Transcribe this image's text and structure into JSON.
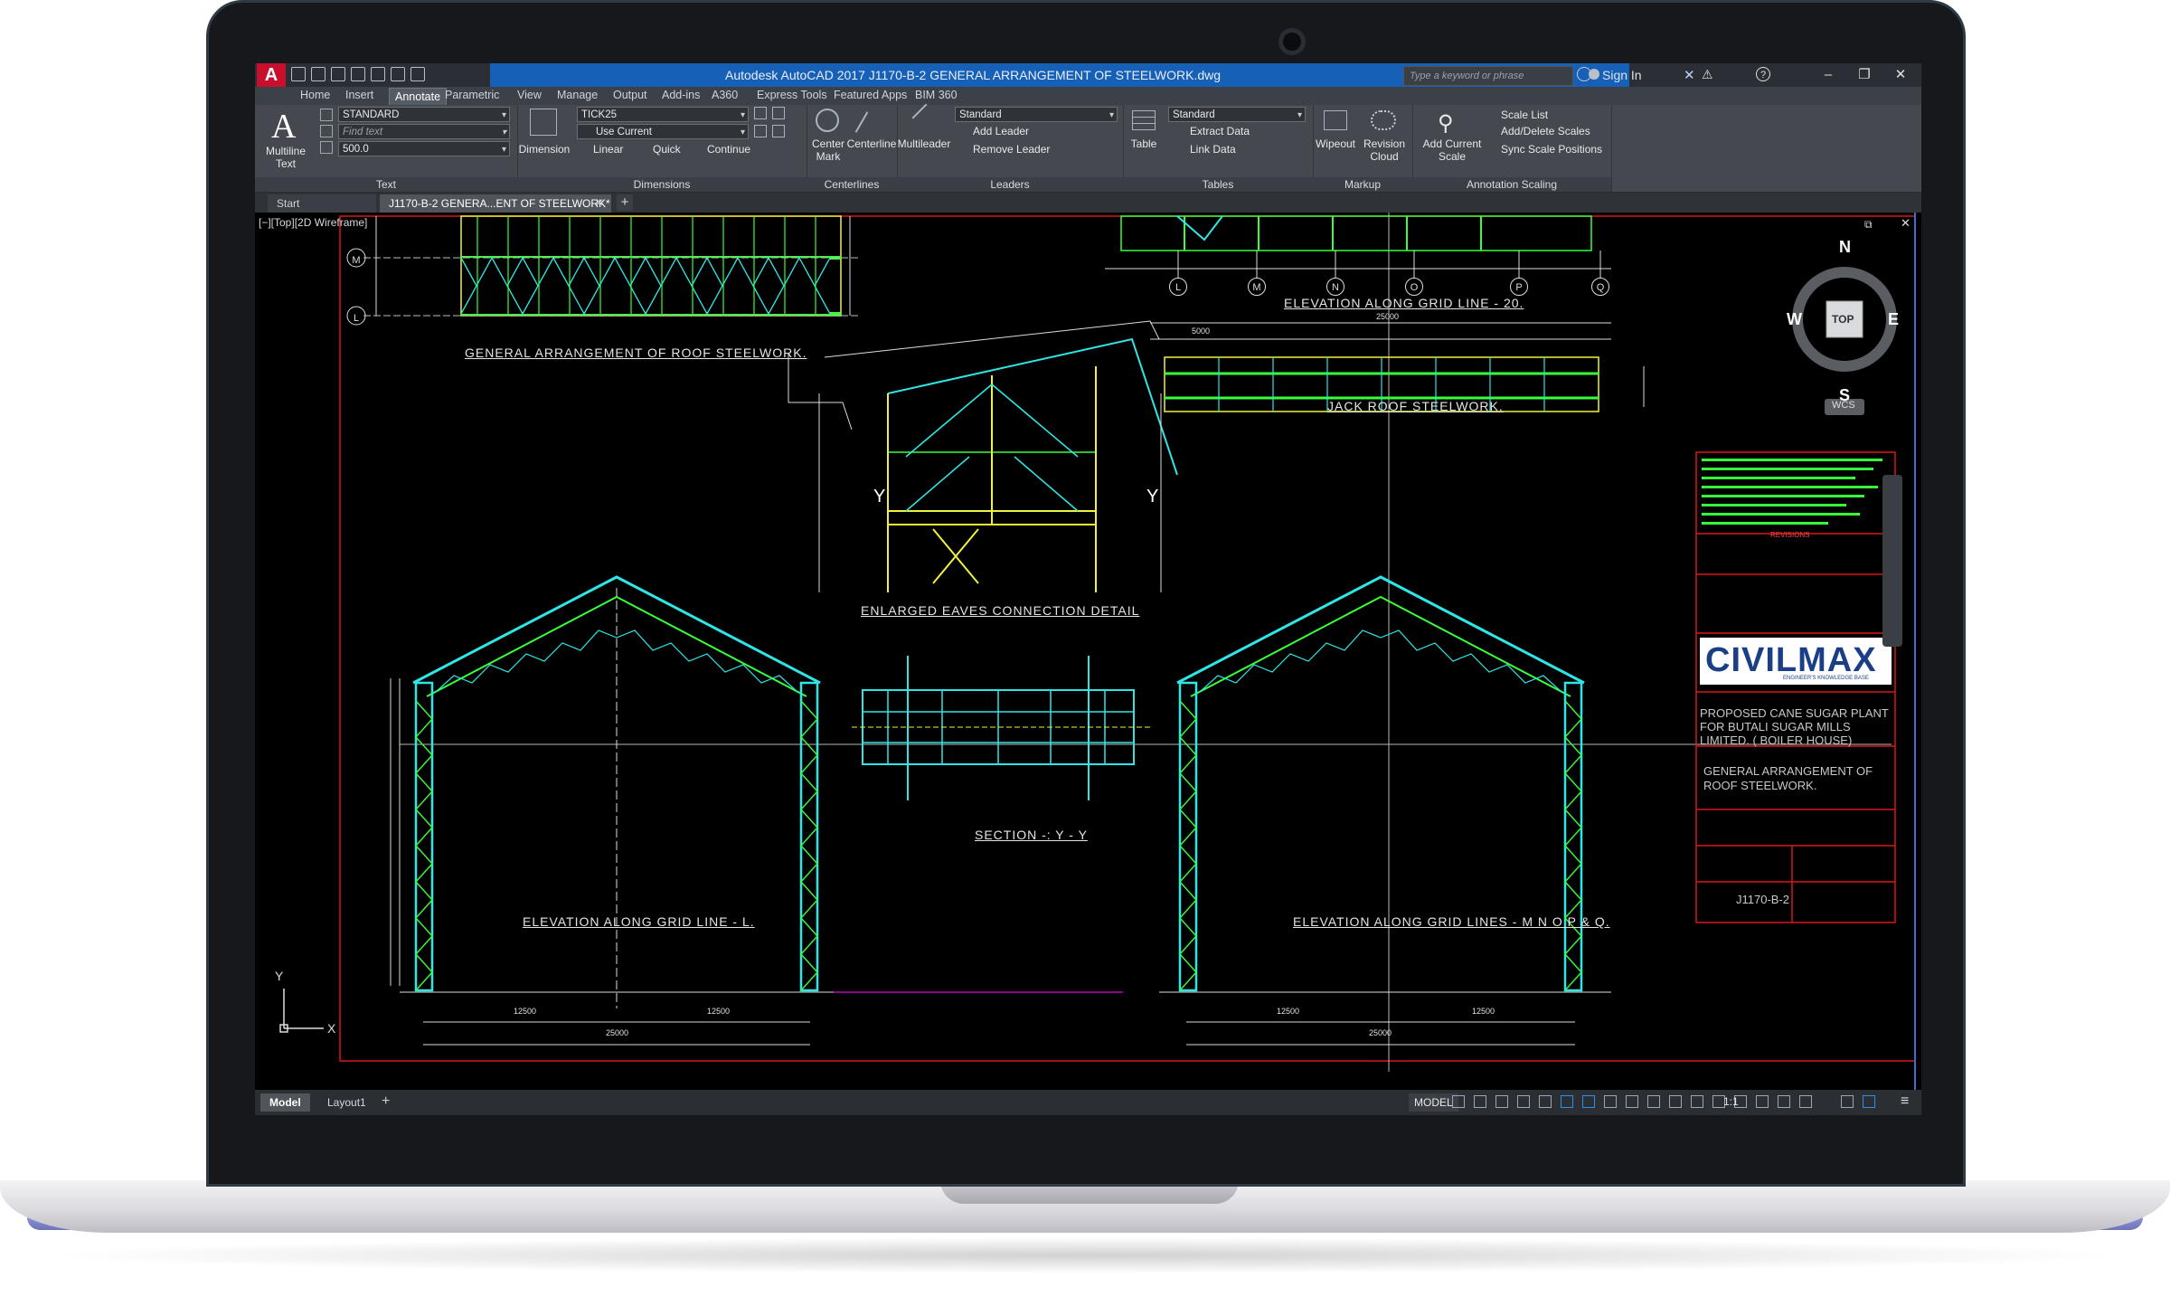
{
  "window": {
    "title": "Autodesk AutoCAD 2017   J1170-B-2  GENERAL  ARRANGEMENT OF STEELWORK.dwg",
    "search_placeholder": "Type a keyword or phrase",
    "sign_in": "Sign In",
    "app_letter": "A"
  },
  "menu_tabs": [
    "Home",
    "Insert",
    "Annotate",
    "Parametric",
    "View",
    "Manage",
    "Output",
    "Add-ins",
    "A360",
    "Express Tools",
    "Featured Apps",
    "BIM 360"
  ],
  "active_tab": "Annotate",
  "ribbon": {
    "text": {
      "title": "Text",
      "multiline_text": "Multiline Text",
      "style_value": "STANDARD",
      "find_placeholder": "Find text",
      "height_value": "500.0"
    },
    "dimensions": {
      "title": "Dimensions",
      "dimension": "Dimension",
      "dimstyle_value": "TICK25",
      "layer_value": "Use Current",
      "linear": "Linear",
      "quick": "Quick",
      "continue": "Continue"
    },
    "centerlines": {
      "title": "Centerlines",
      "center_mark": "Center Mark",
      "centerline": "Centerline"
    },
    "leaders": {
      "title": "Leaders",
      "multileader": "Multileader",
      "style_value": "Standard",
      "add_leader": "Add Leader",
      "remove_leader": "Remove Leader"
    },
    "tables": {
      "title": "Tables",
      "table": "Table",
      "style_value": "Standard",
      "extract_data": "Extract Data",
      "link_data": "Link Data"
    },
    "markup": {
      "title": "Markup",
      "wipeout": "Wipeout",
      "revision_cloud": "Revision Cloud"
    },
    "annotation_scaling": {
      "title": "Annotation Scaling",
      "add_current_scale": "Add Current Scale",
      "scale_list": "Scale List",
      "add_delete_scales": "Add/Delete Scales",
      "sync_scale_positions": "Sync Scale Positions"
    }
  },
  "file_tabs": {
    "start": "Start",
    "drawing": "J1170-B-2  GENERA...ENT OF STEELWORK*"
  },
  "viewport": {
    "label": "[−][Top][2D Wireframe]",
    "viewcube": {
      "n": "N",
      "s": "S",
      "e": "E",
      "w": "W",
      "face": "TOP",
      "wcs": "WCS"
    },
    "ucs": {
      "x": "X",
      "y": "Y"
    }
  },
  "drawing": {
    "views": {
      "roof_plan": "GENERAL ARRANGEMENT OF ROOF STEELWORK.",
      "eaves": "ENLARGED  EAVES  CONNECTION DETAIL",
      "jack_roof": "JACK  ROOF STEELWORK.",
      "elev_20": "ELEVATION  ALONG  GRID LINE - 20.",
      "elev_l": "ELEVATION  ALONG  GRID LINE - L.",
      "elev_m": "ELEVATION  ALONG  GRID LINES - M  N  O  P & Q.",
      "section": "SECTION -: Y - Y"
    },
    "grid_bubbles_top": [
      "L",
      "M",
      "N",
      "O",
      "P",
      "Q"
    ],
    "grid_bubbles_left": [
      "M",
      "L"
    ],
    "dimensions": {
      "span": "25000",
      "half": "12500",
      "bay": "5000"
    },
    "section_marks": [
      "Y",
      "Y"
    ],
    "title_block": {
      "revisions": "REVISIONS",
      "logo": "CIVILMAX",
      "logo_sub": "ENGINEER'S KNOWLEDGE BASE",
      "project": "PROPOSED  CANE SUGAR PLANT FOR BUTALI SUGAR MILLS LIMITED. ( BOILER HOUSE)",
      "drawing_title": "GENERAL ARRANGEMENT OF ROOF STEELWORK.",
      "drawing_no": "J1170-B-2"
    }
  },
  "status": {
    "model_tab": "Model",
    "layout_tab": "Layout1",
    "model_space": "MODEL",
    "scale": "1:1"
  },
  "colors": {
    "title_blue": "#1660b8",
    "logo_red": "#c8102e",
    "steel_cyan": "#2ee6e6",
    "steel_green": "#39ff3a",
    "steel_yellow": "#f2f23a",
    "border_red": "#d81818"
  }
}
